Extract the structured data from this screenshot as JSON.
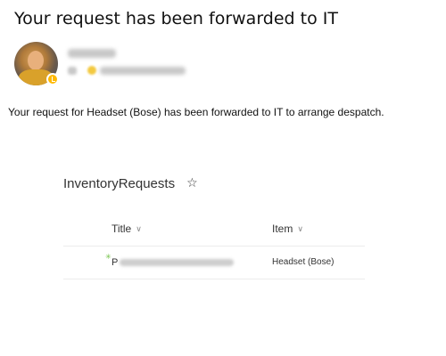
{
  "email": {
    "subject": "Your request has been forwarded to IT",
    "message": "Your request for Headset (Bose) has been forwarded to IT to arrange despatch."
  },
  "sender": {
    "avatar_icon": "person-photo",
    "presence_icon": "presence-away-icon",
    "presence_color": "#ffb900"
  },
  "list": {
    "title": "InventoryRequests",
    "favorite_icon": "☆",
    "columns": {
      "title": "Title",
      "item": "Item"
    },
    "sort_icon": "∨",
    "new_icon": "✳",
    "rows": [
      {
        "title_initial": "P",
        "item": "Headset (Bose)"
      }
    ]
  }
}
